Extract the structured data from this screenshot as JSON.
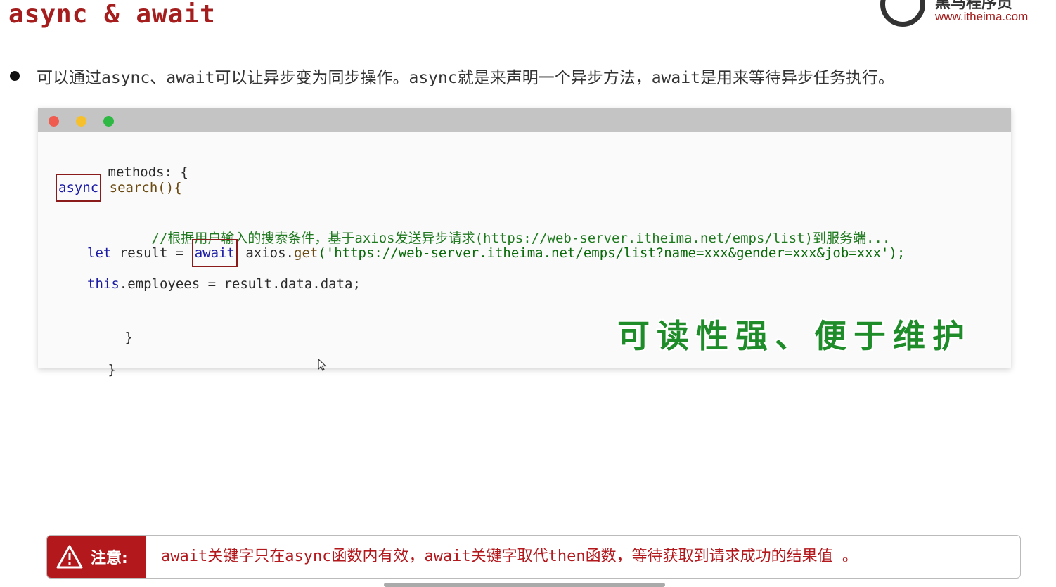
{
  "slide": {
    "title": "async & await",
    "logo": {
      "name": "黑马程序员",
      "url": "www.itheima.com"
    },
    "bullet": "可以通过async、await可以让异步变为同步操作。async就是来声明一个异步方法，await是用来等待异步任务执行。"
  },
  "code": {
    "line1": "methods: {",
    "line2_async": "async",
    "line2_rest": " search(){",
    "line3_comment": "//根据用户输入的搜索条件，基于axios发送异步请求(https://web-server.itheima.net/emps/list)到服务端...",
    "line4_let": "let",
    "line4_result": " result = ",
    "line4_await": "await",
    "line4_axios": " axios.",
    "line4_get": "get",
    "line4_url": "('https://web-server.itheima.net/emps/list?name=xxx&gender=xxx&job=xxx');",
    "line5_this": "this",
    "line5_rest": ".employees = result.data.data;",
    "line6": "}",
    "line7": "}"
  },
  "slogan": "可读性强、便于维护",
  "note": {
    "label": "注意:",
    "text": "await关键字只在async函数内有效，await关键字取代then函数，等待获取到请求成功的结果值 。"
  },
  "colors": {
    "title": "#a51d1d",
    "note_label_bg": "#b3181d",
    "slogan": "#1f8c2a"
  }
}
